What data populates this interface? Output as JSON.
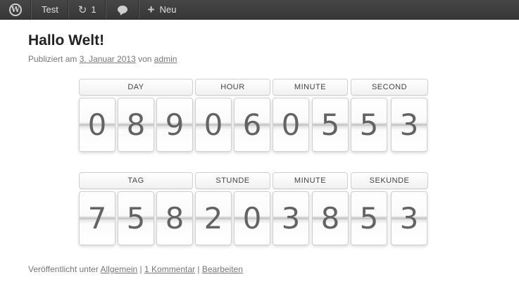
{
  "adminbar": {
    "site_name": "Test",
    "updates_count": "1",
    "new_label": "Neu",
    "icons": [
      "wordpress-logo-icon",
      "refresh-icon",
      "comment-icon",
      "plus-icon"
    ],
    "logo_letter": "W"
  },
  "post": {
    "title": "Hallo Welt!",
    "meta_prefix": "Publiziert am ",
    "date": "3. Januar 2013",
    "meta_mid": " von ",
    "author": "admin",
    "footer_prefix": "Veröffentlicht unter ",
    "category": "Allgemein",
    "sep1": " | ",
    "comments": "1 Kommentar",
    "sep2": " | ",
    "edit": "Bearbeiten"
  },
  "countdown1": {
    "labels": [
      "DAY",
      "HOUR",
      "MINUTE",
      "SECOND"
    ],
    "digits": [
      "0",
      "8",
      "9",
      "0",
      "6",
      "0",
      "5",
      "5",
      "3"
    ]
  },
  "countdown2": {
    "labels": [
      "TAG",
      "STUNDE",
      "MINUTE",
      "SEKUNDE"
    ],
    "digits": [
      "7",
      "5",
      "8",
      "2",
      "0",
      "3",
      "8",
      "5",
      "3"
    ]
  }
}
